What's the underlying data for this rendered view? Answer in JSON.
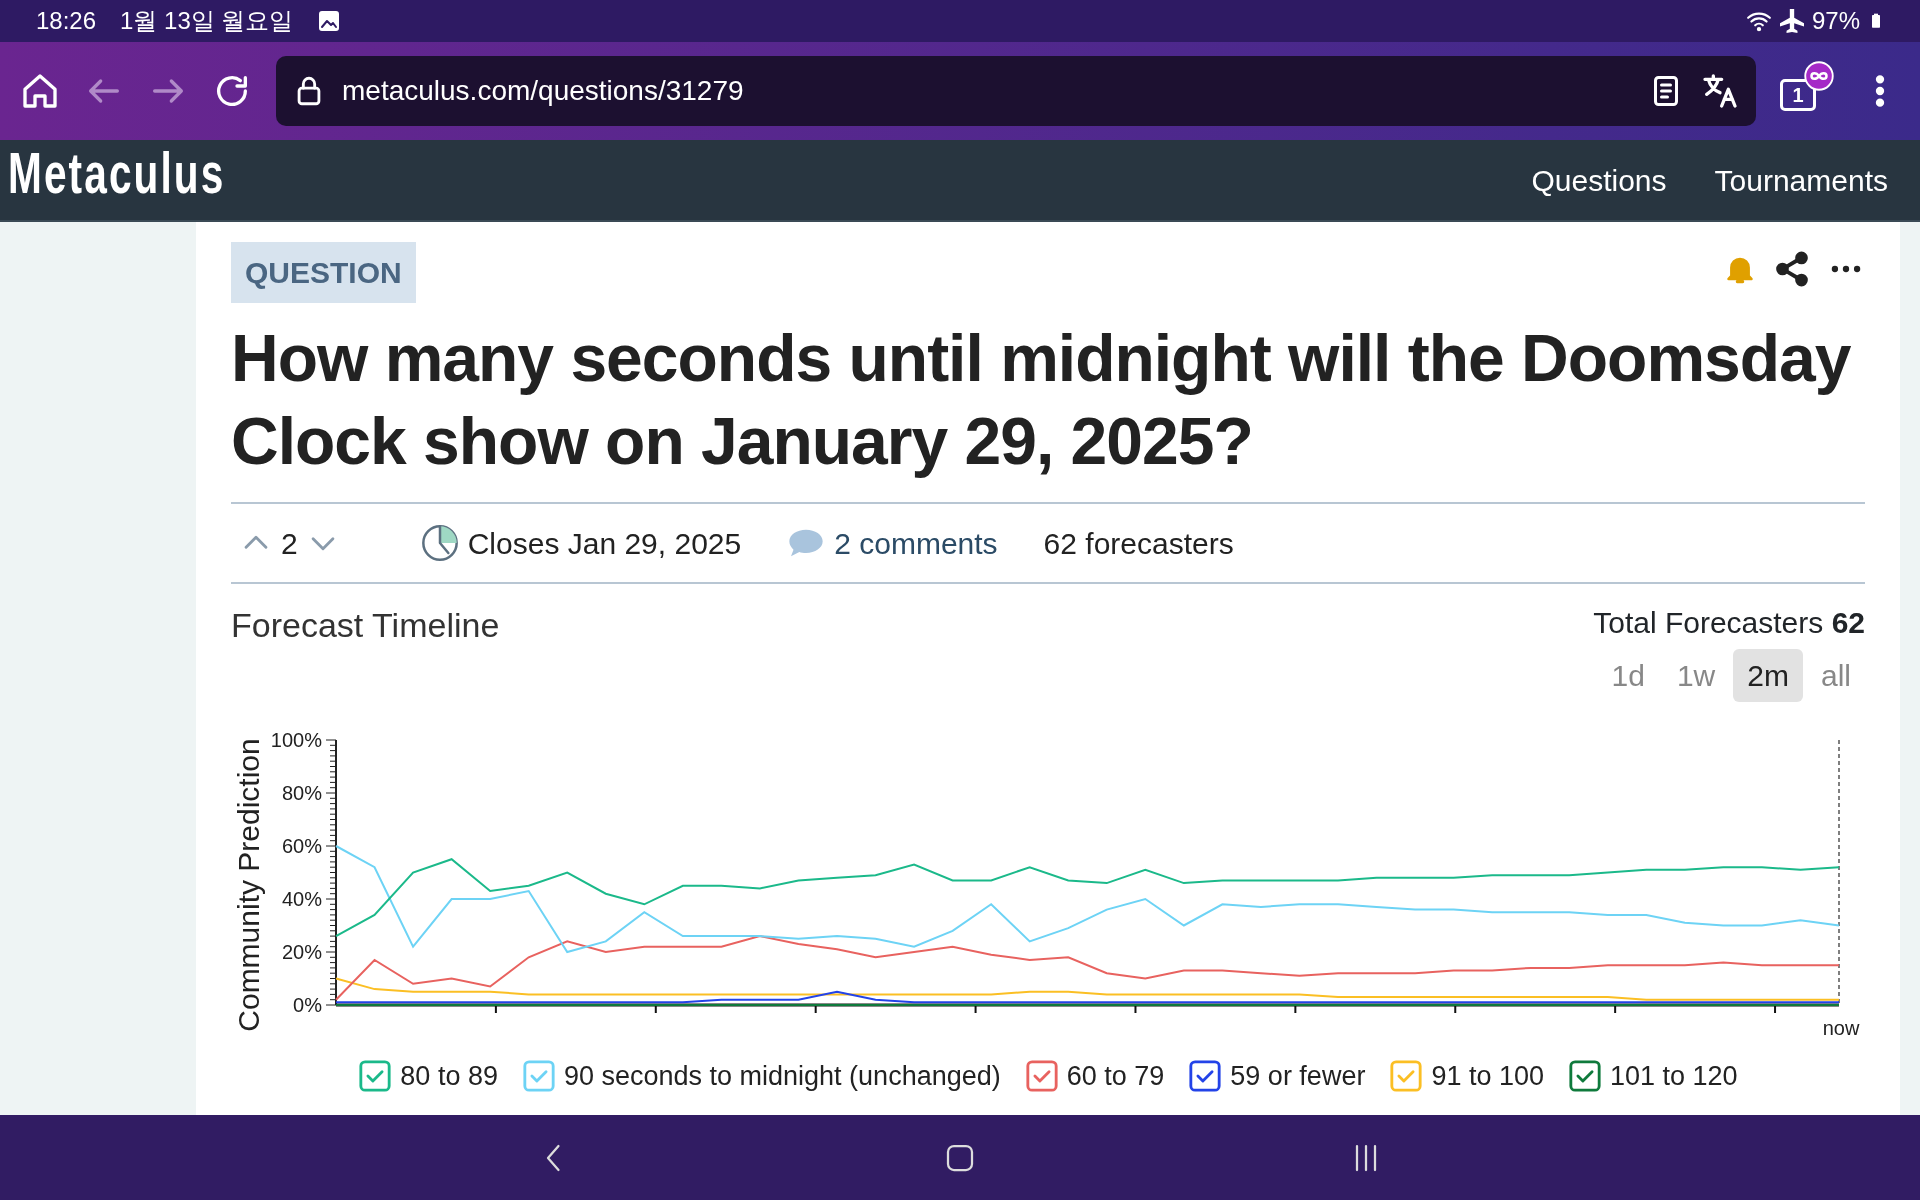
{
  "status_bar": {
    "time": "18:26",
    "date": "1월 13일 월요일",
    "battery": "97%"
  },
  "browser": {
    "url": "metaculus.com/questions/31279",
    "back_disabled": true,
    "forward_disabled": true,
    "tab_count": "1"
  },
  "site_header": {
    "logo": "Metaculus",
    "nav": [
      "Questions",
      "Tournaments"
    ]
  },
  "question": {
    "tag": "QUESTION",
    "title": "How many seconds until midnight will the Doomsday Clock show on January 29, 2025?",
    "votes": "2",
    "closes": "Closes Jan 29, 2025",
    "comments": "2 comments",
    "forecasters": "62 forecasters"
  },
  "timeline": {
    "title": "Forecast Timeline",
    "total_label": "Total Forecasters",
    "total_value": "62",
    "ranges": [
      {
        "label": "1d",
        "selected": false
      },
      {
        "label": "1w",
        "selected": false
      },
      {
        "label": "2m",
        "selected": true
      },
      {
        "label": "all",
        "selected": false
      }
    ],
    "legend": [
      {
        "checked": true
      },
      {
        "checked": true
      },
      {
        "checked": true
      },
      {
        "checked": true
      },
      {
        "checked": true
      },
      {
        "checked": true
      }
    ],
    "chart_data": {
      "type": "line",
      "ylabel": "Community Prediction",
      "ylim": [
        0,
        100
      ],
      "yticks": [
        {
          "value": 0,
          "label": "0%"
        },
        {
          "value": 20,
          "label": "20%"
        },
        {
          "value": 40,
          "label": "40%"
        },
        {
          "value": 60,
          "label": "60%"
        },
        {
          "value": 80,
          "label": "80%"
        },
        {
          "value": 100,
          "label": "100%"
        }
      ],
      "annotations": [
        "now"
      ],
      "series": [
        {
          "name": "80 to 89",
          "color": "#1bb98a",
          "values": [
            26,
            34,
            50,
            55,
            43,
            45,
            50,
            42,
            38,
            45,
            45,
            44,
            47,
            48,
            49,
            53,
            47,
            47,
            52,
            47,
            46,
            51,
            46,
            47,
            47,
            47,
            47,
            48,
            48,
            48,
            49,
            49,
            49,
            50,
            51,
            51,
            52,
            52,
            51,
            52
          ]
        },
        {
          "name": "90 seconds to midnight (unchanged)",
          "color": "#6dd3f5",
          "values": [
            60,
            52,
            22,
            40,
            40,
            43,
            20,
            24,
            35,
            26,
            26,
            26,
            25,
            26,
            25,
            22,
            28,
            38,
            24,
            29,
            36,
            40,
            30,
            38,
            37,
            38,
            38,
            37,
            36,
            36,
            35,
            35,
            35,
            34,
            34,
            31,
            30,
            30,
            32,
            30
          ]
        },
        {
          "name": "60 to 79",
          "color": "#e8625f",
          "values": [
            2,
            17,
            8,
            10,
            7,
            18,
            24,
            20,
            22,
            22,
            22,
            26,
            23,
            21,
            18,
            20,
            22,
            19,
            17,
            18,
            12,
            10,
            13,
            13,
            12,
            11,
            12,
            12,
            12,
            13,
            13,
            14,
            14,
            15,
            15,
            15,
            16,
            15,
            15,
            15
          ]
        },
        {
          "name": "59 or fewer",
          "color": "#2343e8",
          "values": [
            1,
            1,
            1,
            1,
            1,
            1,
            1,
            1,
            1,
            1,
            2,
            2,
            2,
            5,
            2,
            1,
            1,
            1,
            1,
            1,
            1,
            1,
            1,
            1,
            1,
            1,
            1,
            1,
            1,
            1,
            1,
            1,
            1,
            1,
            1,
            1,
            1,
            1,
            1,
            1
          ]
        },
        {
          "name": "91 to 100",
          "color": "#fbbf24",
          "values": [
            10,
            6,
            5,
            5,
            5,
            4,
            4,
            4,
            4,
            4,
            4,
            4,
            4,
            4,
            4,
            4,
            4,
            4,
            5,
            5,
            4,
            4,
            4,
            4,
            4,
            4,
            3,
            3,
            3,
            3,
            3,
            3,
            3,
            3,
            2,
            2,
            2,
            2,
            2,
            2
          ]
        },
        {
          "name": "101 to 120",
          "color": "#0f7a3c",
          "values": [
            0,
            0,
            0,
            0,
            0,
            0,
            0,
            0,
            0,
            0,
            0,
            0,
            0,
            0,
            0,
            0,
            0,
            0,
            0,
            0,
            0,
            0,
            0,
            0,
            0,
            0,
            0,
            0,
            0,
            0,
            0,
            0,
            0,
            0,
            0,
            0,
            0,
            0,
            0,
            0
          ]
        }
      ]
    }
  }
}
